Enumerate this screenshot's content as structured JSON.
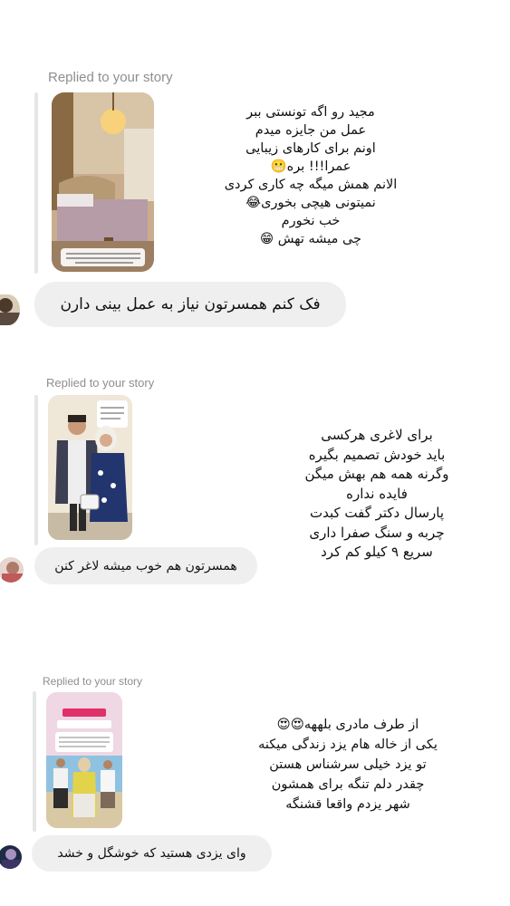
{
  "messages": [
    {
      "replied_label": "Replied to your story",
      "story_text": "مجید رو اگه تونستی ببر\nعمل من جایزه میدم\nاونم برای کارهای زیبایی\nعمرا!!! بره😬\nالانم همش میگه چه کاری کردی\nنمیتونی هیچی بخوری😂\nخب نخورم\nچی میشه تهش 😁",
      "reply": "فک کنم همسرتون نیاز به عمل بینی دارن"
    },
    {
      "replied_label": "Replied to your story",
      "story_text": "برای لاغری هرکسی\nباید خودش تصمیم بگیره\nوگرنه همه هم بهش میگن\nفایده نداره\nپارسال دکتر گفت کبدت\nچربه و سنگ صفرا داری\nسریع ۹ کیلو کم کرد",
      "reply": "همسرتون هم خوب میشه لاغر کنن"
    },
    {
      "replied_label": "Replied to your story",
      "story_text": "از طرف مادری بلههه😍😍\nیکی از خاله هام یزد زندگی میکنه\nتو یزد خیلی سرشناس هستن\nچقدر دلم تنگه برای همشون\nشهر یزدم واقعا قشنگه",
      "reply": "وای یزدی   هستید   که  خوشگل و خشد"
    }
  ]
}
